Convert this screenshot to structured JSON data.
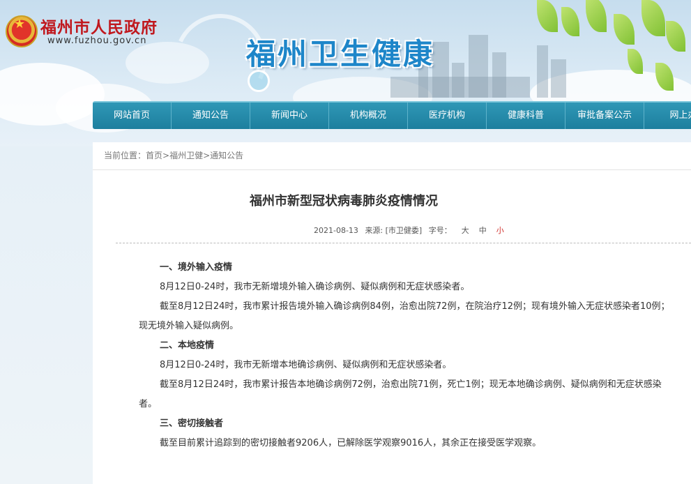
{
  "header": {
    "gov_title": "福州市人民政府",
    "gov_url": "www.fuzhou.gov.cn",
    "site_title": "福州卫生健康"
  },
  "nav": {
    "items": [
      "网站首页",
      "通知公告",
      "新闻中心",
      "机构概况",
      "医疗机构",
      "健康科普",
      "审批备案公示",
      "网上办"
    ]
  },
  "breadcrumb": {
    "prefix": "当前位置：",
    "items": [
      "首页",
      "福州卫健",
      "通知公告"
    ],
    "separator": ">"
  },
  "article": {
    "title": "福州市新型冠状病毒肺炎疫情情况",
    "date": "2021-08-13",
    "source": "来源: [市卫健委]",
    "font_size_label": "字号：",
    "font_sizes": [
      "大",
      "中",
      "小"
    ],
    "paragraphs": [
      {
        "type": "heading",
        "text": "一、境外输入疫情"
      },
      {
        "type": "text",
        "text": "8月12日0-24时，我市无新增境外输入确诊病例、疑似病例和无症状感染者。"
      },
      {
        "type": "text",
        "text": "截至8月12日24时，我市累计报告境外输入确诊病例84例，治愈出院72例，在院治疗12例；现有境外输入无症状感染者10例；现无境外输入疑似病例。"
      },
      {
        "type": "heading",
        "text": "二、本地疫情"
      },
      {
        "type": "text",
        "text": "8月12日0-24时，我市无新增本地确诊病例、疑似病例和无症状感染者。"
      },
      {
        "type": "text",
        "text": "截至8月12日24时，我市累计报告本地确诊病例72例，治愈出院71例，死亡1例；现无本地确诊病例、疑似病例和无症状感染者。"
      },
      {
        "type": "heading",
        "text": "三、密切接触者"
      },
      {
        "type": "text",
        "text": "截至目前累计追踪到的密切接触者9206人，已解除医学观察9016人，其余正在接受医学观察。"
      }
    ]
  },
  "colors": {
    "gov_red": "#c0181e",
    "site_blue": "#1e86c9",
    "nav_teal": "#1d7f9e",
    "accent_small": "#d0312d"
  }
}
